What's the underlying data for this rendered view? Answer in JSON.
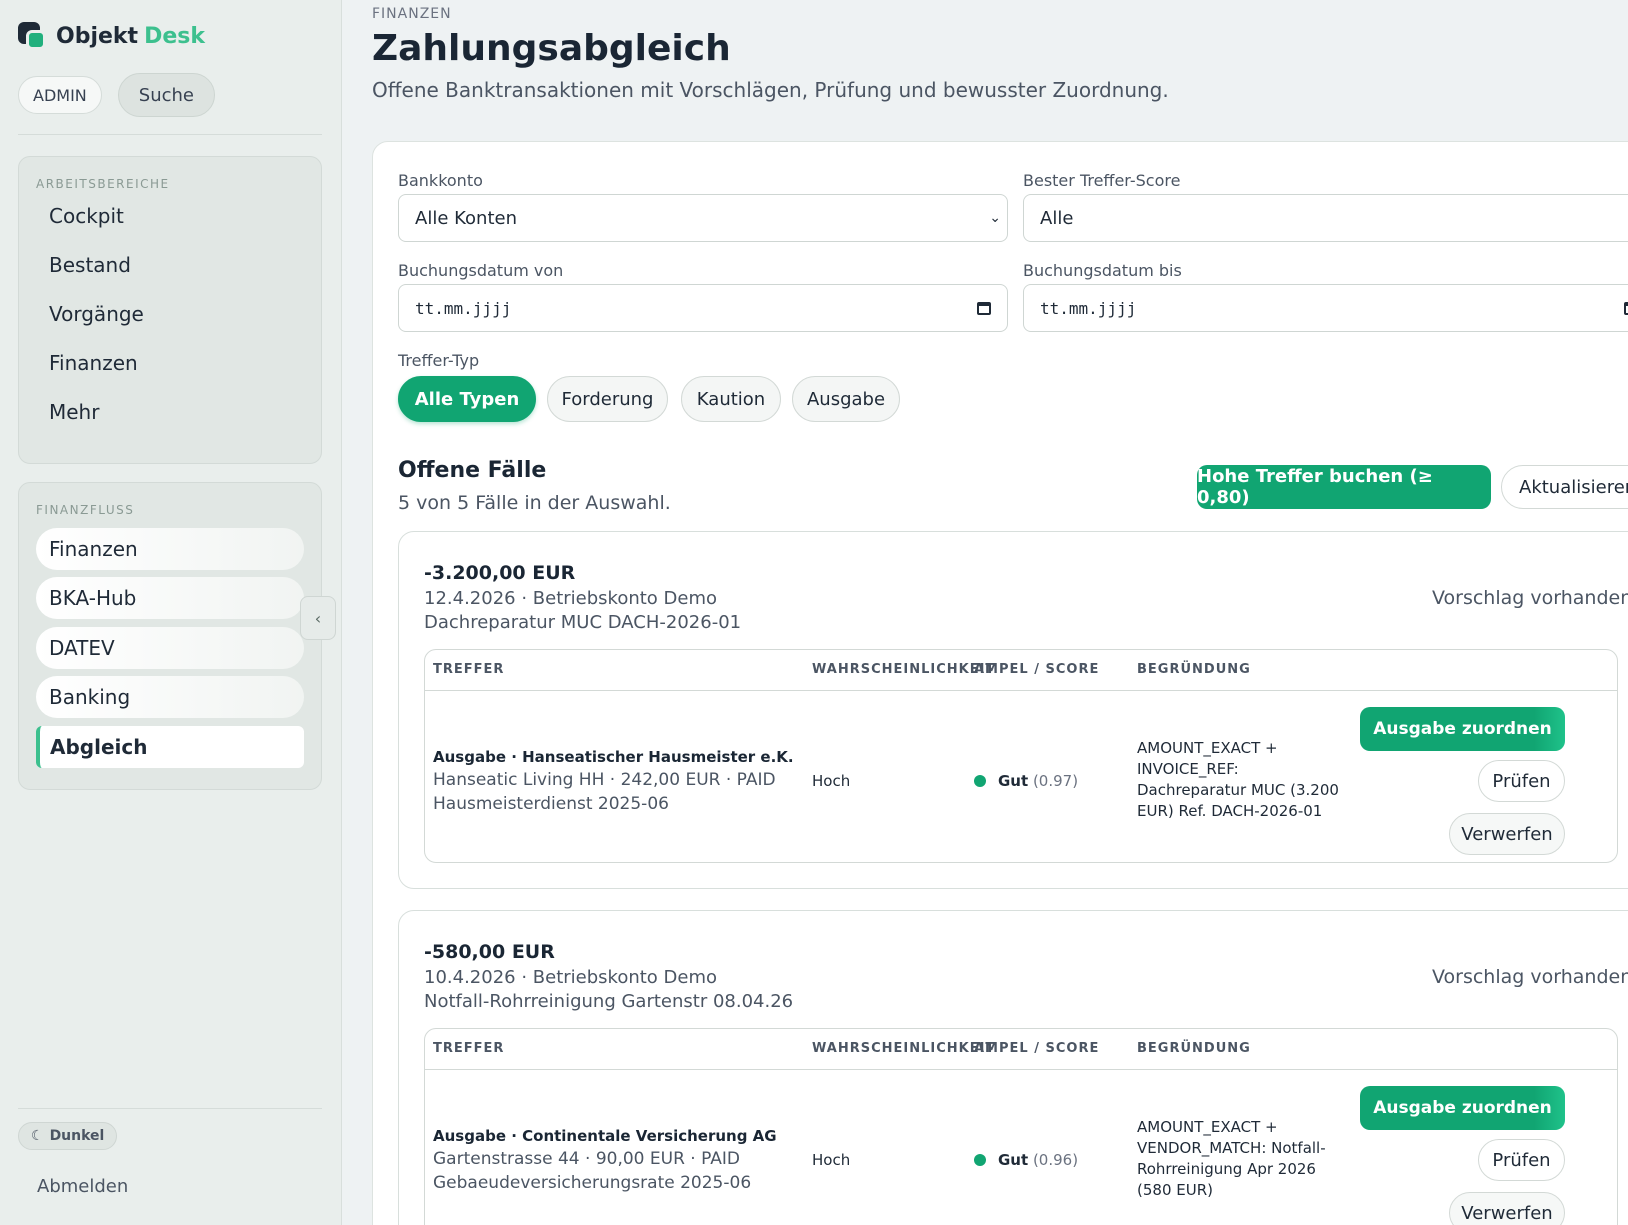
{
  "app": {
    "name_part1": "Objekt",
    "name_part2": "Desk"
  },
  "top_pills": {
    "admin": "ADMIN",
    "search": "Suche"
  },
  "sidebar": {
    "section1_heading": "ARBEITSBEREICHE",
    "section1_items": [
      "Cockpit",
      "Bestand",
      "Vorgänge",
      "Finanzen",
      "Mehr"
    ],
    "section2_heading": "FINANZFLUSS",
    "section2_items": [
      "Finanzen",
      "BKA-Hub",
      "DATEV",
      "Banking",
      "Abgleich"
    ],
    "active_item": "Abgleich",
    "theme_toggle": "Dunkel",
    "logout": "Abmelden"
  },
  "header": {
    "breadcrumb": "FINANZEN",
    "title": "Zahlungsabgleich",
    "subtitle": "Offene Banktransaktionen mit Vorschlägen, Prüfung und bewusster Zuordnung."
  },
  "filters": {
    "bank_label": "Bankkonto",
    "bank_value": "Alle Konten",
    "score_label": "Bester Treffer-Score",
    "score_value": "Alle",
    "date_from_label": "Buchungsdatum von",
    "date_from_placeholder": "tt.mm.jjjj",
    "date_to_label": "Buchungsdatum bis",
    "date_to_placeholder": "tt.mm.jjjj",
    "type_label": "Treffer-Typ",
    "type_chips": [
      "Alle Typen",
      "Forderung",
      "Kaution",
      "Ausgabe"
    ],
    "type_active": "Alle Typen"
  },
  "cases_section": {
    "title": "Offene Fälle",
    "count_text": "5 von 5 Fälle in der Auswahl.",
    "book_button": "Hohe Treffer buchen (≥ 0,80)",
    "refresh_button": "Aktualisieren"
  },
  "table_headers": {
    "match": "TREFFER",
    "probability": "WAHRSCHEINLICHKEIT",
    "score": "AMPEL / SCORE",
    "reason": "BEGRÜNDUNG"
  },
  "cases": [
    {
      "amount": "-3.200,00 EUR",
      "date_account": "12.4.2026 · Betriebskonto Demo",
      "reference": "Dachreparatur MUC DACH-2026-01",
      "status": "Vorschlag vorhanden",
      "match_title": "Ausgabe · Hanseatischer Hausmeister e.K.",
      "match_line1": "Hanseatic Living HH · 242,00 EUR · PAID",
      "match_line2": "Hausmeisterdienst 2025-06",
      "probability": "Hoch",
      "score_label": "Gut",
      "score_value": "(0.97)",
      "reason": "AMOUNT_EXACT + INVOICE_REF: Dachreparatur MUC (3.200 EUR) Ref. DACH-2026-01",
      "assign_button": "Ausgabe zuordnen",
      "check_button": "Prüfen",
      "reject_button": "Verwerfen"
    },
    {
      "amount": "-580,00 EUR",
      "date_account": "10.4.2026 · Betriebskonto Demo",
      "reference": "Notfall-Rohrreinigung Gartenstr 08.04.26",
      "status": "Vorschlag vorhanden",
      "match_title": "Ausgabe · Continentale Versicherung AG",
      "match_line1": "Gartenstrasse 44 · 90,00 EUR · PAID",
      "match_line2": "Gebaeudeversicherungsrate 2025-06",
      "probability": "Hoch",
      "score_label": "Gut",
      "score_value": "(0.96)",
      "reason": "AMOUNT_EXACT + VENDOR_MATCH: Notfall-Rohrreinigung Apr 2026 (580 EUR)",
      "assign_button": "Ausgabe zuordnen",
      "check_button": "Prüfen",
      "reject_button": "Verwerfen"
    }
  ],
  "colors": {
    "accent": "#11a572",
    "brand_green": "#3cc08e",
    "sidebar_bg": "#e9eeec"
  },
  "icons": {
    "logo": "objekt-desk-logo-icon",
    "collapse": "chevron-left-icon",
    "theme": "moon-icon",
    "calendar": "calendar-icon",
    "dropdown": "chevron-down-icon"
  }
}
